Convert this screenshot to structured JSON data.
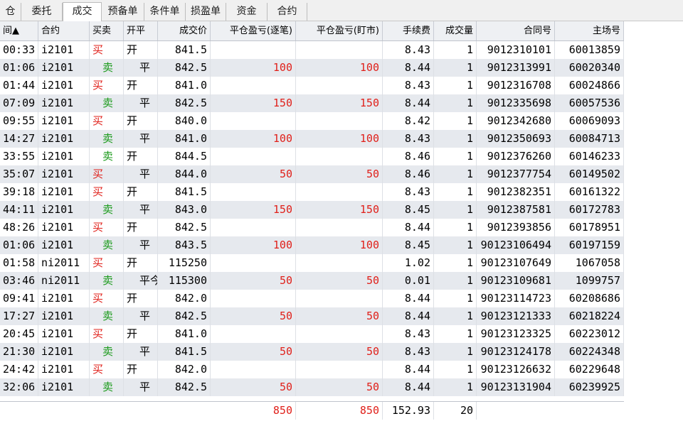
{
  "tabs": [
    {
      "label": "仓",
      "active": false
    },
    {
      "label": "委托",
      "active": false
    },
    {
      "label": "成交",
      "active": true
    },
    {
      "label": "预备单",
      "active": false
    },
    {
      "label": "条件单",
      "active": false
    },
    {
      "label": "损盈单",
      "active": false
    },
    {
      "label": "资金",
      "active": false
    },
    {
      "label": "合约",
      "active": false
    }
  ],
  "table": {
    "headers": [
      "间▲",
      "合约",
      "买卖",
      "开平",
      "成交价",
      "平仓盈亏(逐笔)",
      "平仓盈亏(盯市)",
      "手续费",
      "成交量",
      "合同号",
      "主场号"
    ],
    "rows": [
      [
        "00:33",
        "i2101",
        "买",
        "开",
        "841.5",
        "",
        "",
        "8.43",
        "1",
        "9012310101",
        "60013859"
      ],
      [
        "01:06",
        "i2101",
        "卖",
        "平",
        "842.5",
        "100",
        "100",
        "8.44",
        "1",
        "9012313991",
        "60020340"
      ],
      [
        "01:44",
        "i2101",
        "买",
        "开",
        "841.0",
        "",
        "",
        "8.43",
        "1",
        "9012316708",
        "60024866"
      ],
      [
        "07:09",
        "i2101",
        "卖",
        "平",
        "842.5",
        "150",
        "150",
        "8.44",
        "1",
        "9012335698",
        "60057536"
      ],
      [
        "09:55",
        "i2101",
        "买",
        "开",
        "840.0",
        "",
        "",
        "8.42",
        "1",
        "9012342680",
        "60069093"
      ],
      [
        "14:27",
        "i2101",
        "卖",
        "平",
        "841.0",
        "100",
        "100",
        "8.43",
        "1",
        "9012350693",
        "60084713"
      ],
      [
        "33:55",
        "i2101",
        "卖",
        "开",
        "844.5",
        "",
        "",
        "8.46",
        "1",
        "9012376260",
        "60146233"
      ],
      [
        "35:07",
        "i2101",
        "买",
        "平",
        "844.0",
        "50",
        "50",
        "8.46",
        "1",
        "9012377754",
        "60149502"
      ],
      [
        "39:18",
        "i2101",
        "买",
        "开",
        "841.5",
        "",
        "",
        "8.43",
        "1",
        "9012382351",
        "60161322"
      ],
      [
        "44:11",
        "i2101",
        "卖",
        "平",
        "843.0",
        "150",
        "150",
        "8.45",
        "1",
        "9012387581",
        "60172783"
      ],
      [
        "48:26",
        "i2101",
        "买",
        "开",
        "842.5",
        "",
        "",
        "8.44",
        "1",
        "9012393856",
        "60178951"
      ],
      [
        "01:06",
        "i2101",
        "卖",
        "平",
        "843.5",
        "100",
        "100",
        "8.45",
        "1",
        "90123106494",
        "60197159"
      ],
      [
        "01:58",
        "ni2011",
        "买",
        "开",
        "115250",
        "",
        "",
        "1.02",
        "1",
        "90123107649",
        "1067058"
      ],
      [
        "03:46",
        "ni2011",
        "卖",
        "平今",
        "115300",
        "50",
        "50",
        "0.01",
        "1",
        "90123109681",
        "1099757"
      ],
      [
        "09:41",
        "i2101",
        "买",
        "开",
        "842.0",
        "",
        "",
        "8.44",
        "1",
        "90123114723",
        "60208686"
      ],
      [
        "17:27",
        "i2101",
        "卖",
        "平",
        "842.5",
        "50",
        "50",
        "8.44",
        "1",
        "90123121333",
        "60218224"
      ],
      [
        "20:45",
        "i2101",
        "买",
        "开",
        "841.0",
        "",
        "",
        "8.43",
        "1",
        "90123123325",
        "60223012"
      ],
      [
        "21:30",
        "i2101",
        "卖",
        "平",
        "841.5",
        "50",
        "50",
        "8.43",
        "1",
        "90123124178",
        "60224348"
      ],
      [
        "24:42",
        "i2101",
        "买",
        "开",
        "842.0",
        "",
        "",
        "8.44",
        "1",
        "90123126632",
        "60229648"
      ],
      [
        "32:06",
        "i2101",
        "卖",
        "平",
        "842.5",
        "50",
        "50",
        "8.44",
        "1",
        "90123131904",
        "60239925"
      ]
    ],
    "totals": {
      "pnl_trade": "850",
      "pnl_mark": "850",
      "fee": "152.93",
      "volume": "20"
    }
  },
  "colors": {
    "buy": "#e0201a",
    "sell": "#1b9a1b",
    "pnl": "#e0201a",
    "alt_row": "#e6e9ee"
  }
}
